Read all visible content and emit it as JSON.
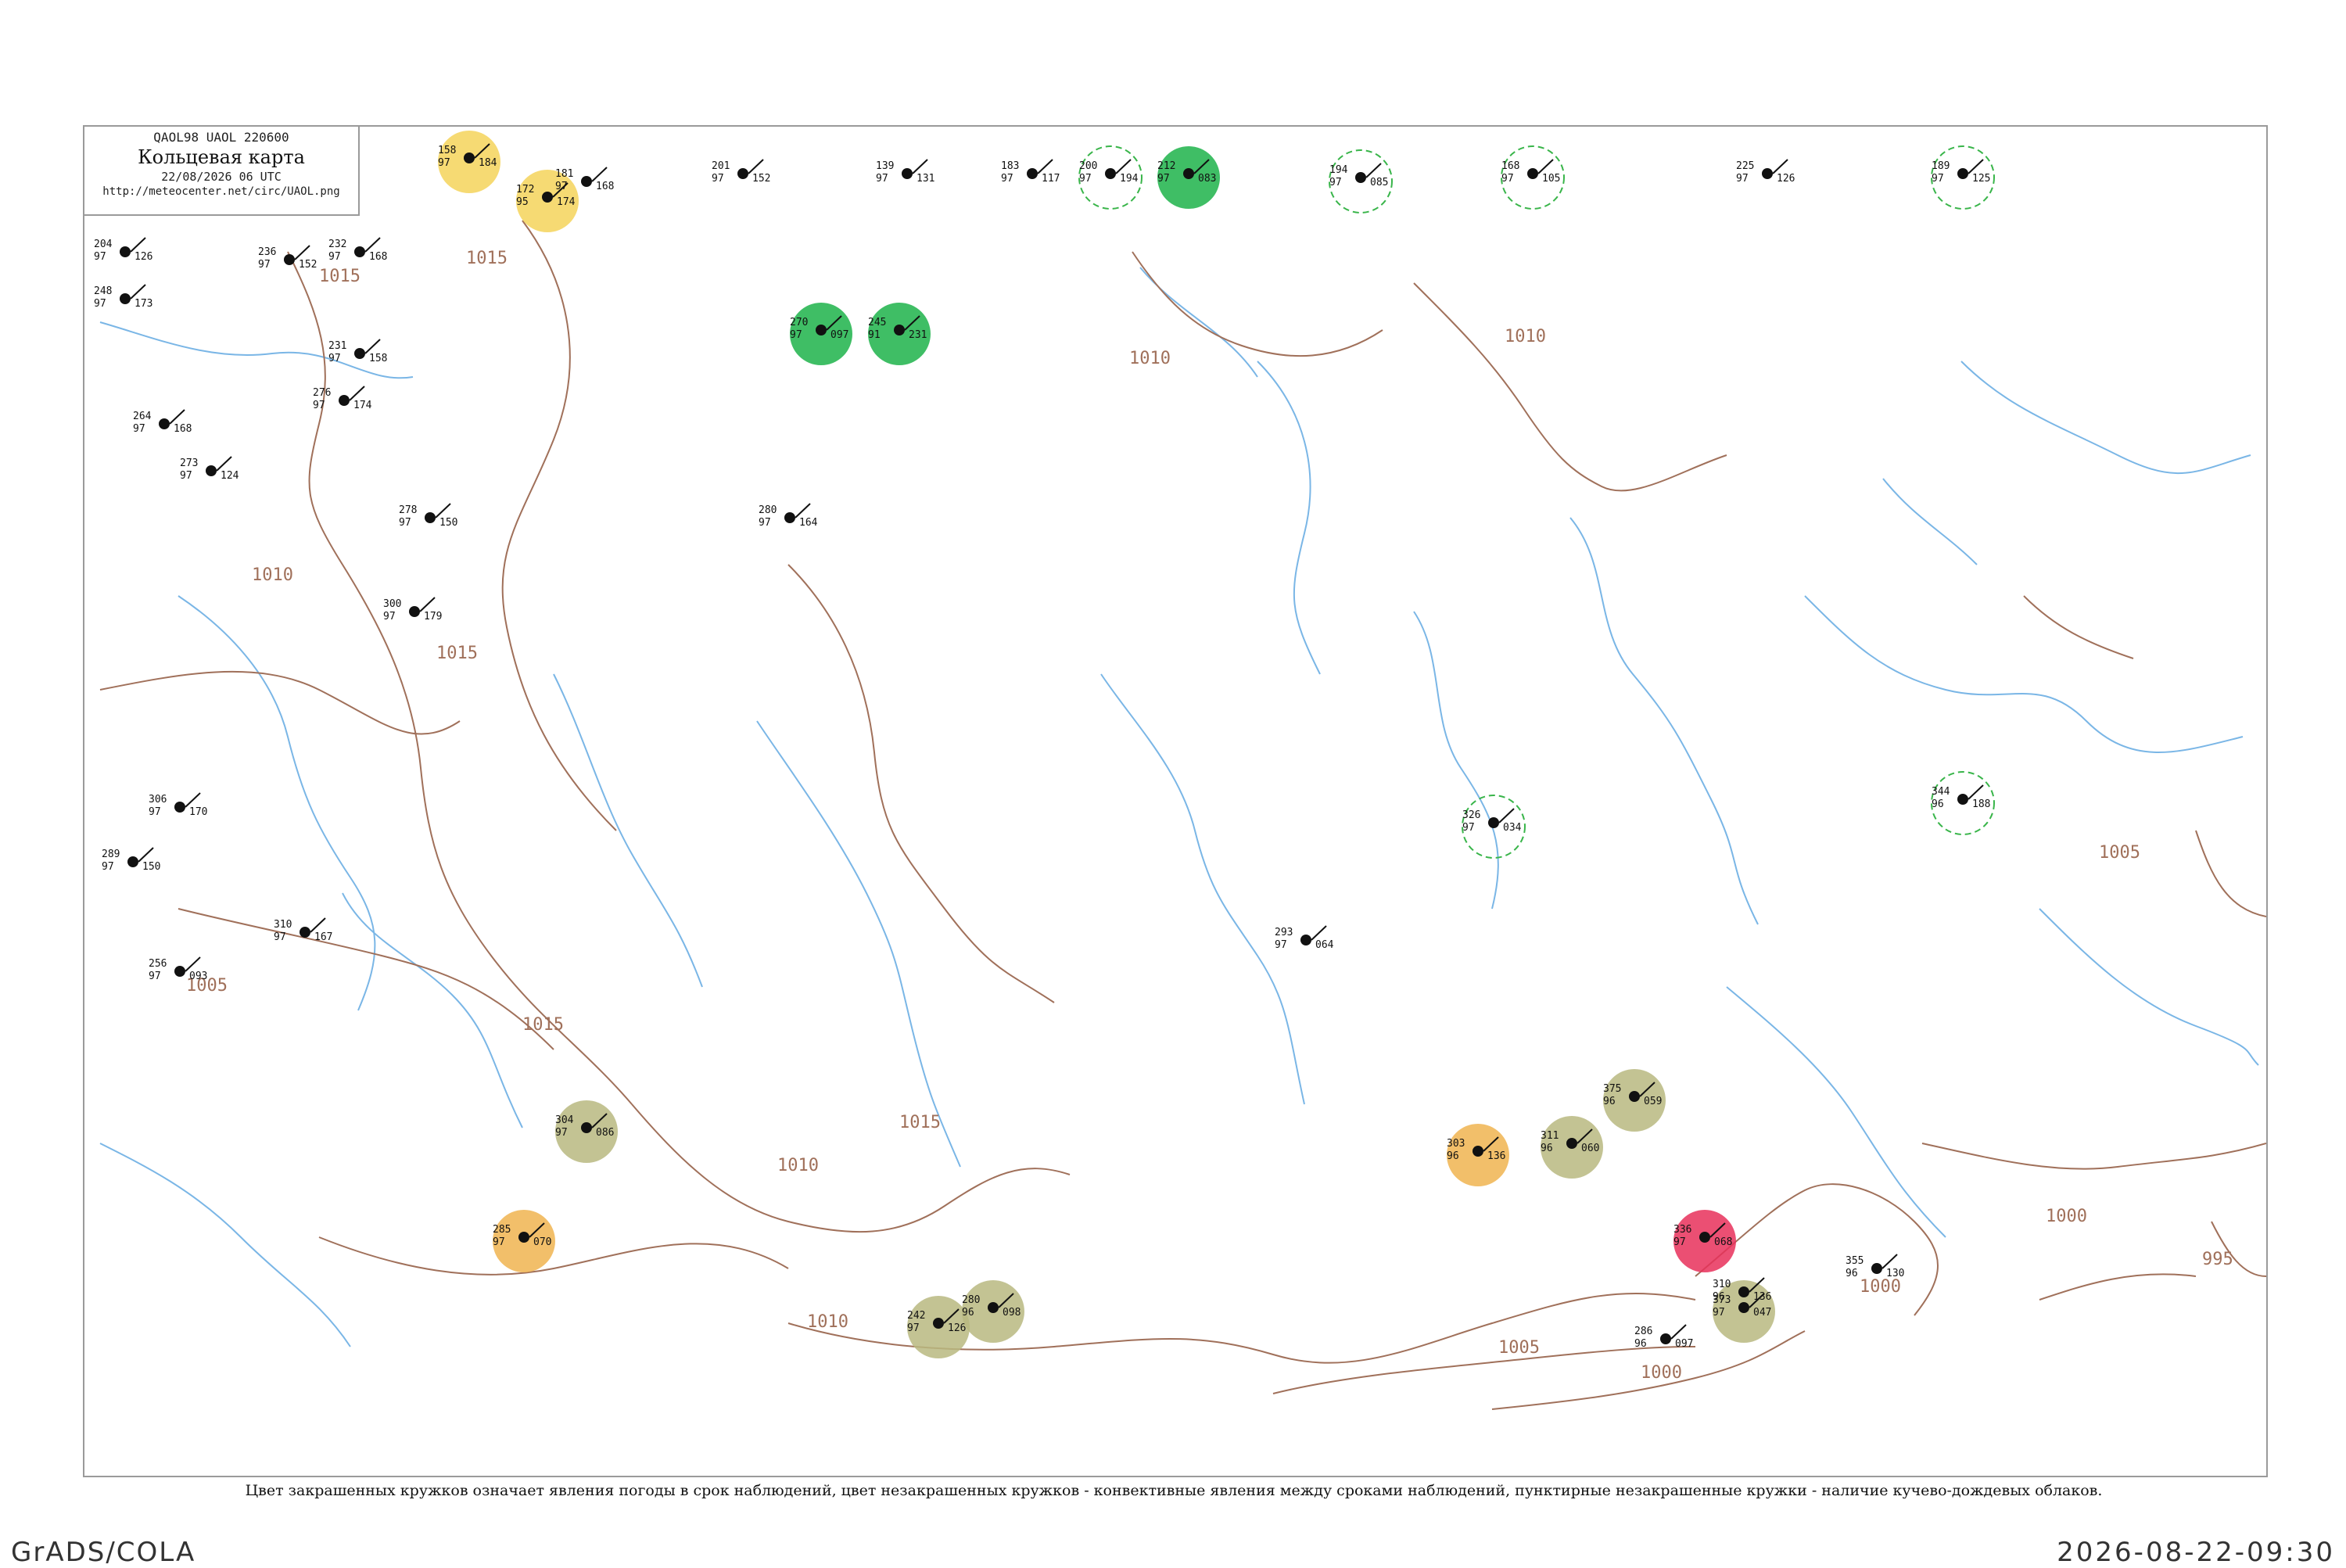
{
  "header": {
    "code": "QAOL98  UAOL  220600",
    "title": "Кольцевая карта",
    "datetime": "22/08/2026 06 UTC",
    "url": "http://meteocenter.net/circ/UAOL.png"
  },
  "caption": "Цвет закрашенных кружков означает явления погоды в срок наблюдений, цвет незакрашенных кружков - конвективные явления между сроками наблюдений, пунктирные незакрашенные кружки - наличие кучево-дождевых облаков.",
  "footer": {
    "left": "GrADS/COLA",
    "right": "2026-08-22-09:30"
  },
  "isobar_labels": [
    "1015",
    "1010",
    "1015",
    "1010",
    "1015",
    "1005",
    "1015",
    "1015",
    "1010",
    "1010",
    "1005",
    "1000",
    "1000",
    "1000",
    "995",
    "1005",
    "1010"
  ],
  "colors": {
    "isobar": "#a0705a",
    "water": "#7ab6e6",
    "rain": "#1db34a",
    "fog": "#f4d45a",
    "haze": "#f0b450",
    "dust": "#b8b880",
    "storm": "#e8305a",
    "cb_ring": "#39b54a"
  },
  "stations": [
    {
      "t": "158",
      "p": "184",
      "v": "97"
    },
    {
      "t": "172",
      "p": "174",
      "v": "95"
    },
    {
      "t": "181",
      "p": "168",
      "v": "97"
    },
    {
      "t": "201",
      "p": "152",
      "v": "97"
    },
    {
      "t": "139",
      "p": "131",
      "v": "97"
    },
    {
      "t": "183",
      "p": "117",
      "v": "97"
    },
    {
      "t": "200",
      "p": "194",
      "v": "97"
    },
    {
      "t": "212",
      "p": "083",
      "v": "97"
    },
    {
      "t": "194",
      "p": "085",
      "v": "97"
    },
    {
      "t": "168",
      "p": "105",
      "v": "97"
    },
    {
      "t": "225",
      "p": "126",
      "v": "97"
    },
    {
      "t": "189",
      "p": "125",
      "v": "97"
    },
    {
      "t": "204",
      "p": "126",
      "v": "97"
    },
    {
      "t": "236",
      "p": "152",
      "v": "97"
    },
    {
      "t": "232",
      "p": "168",
      "v": "97"
    },
    {
      "t": "248",
      "p": "173",
      "v": "97"
    },
    {
      "t": "231",
      "p": "158",
      "v": "97"
    },
    {
      "t": "276",
      "p": "174",
      "v": "97"
    },
    {
      "t": "264",
      "p": "168",
      "v": "97"
    },
    {
      "t": "273",
      "p": "124",
      "v": "97"
    },
    {
      "t": "278",
      "p": "150",
      "v": "97"
    },
    {
      "t": "280",
      "p": "164",
      "v": "97"
    },
    {
      "t": "300",
      "p": "179",
      "v": "97"
    },
    {
      "t": "306",
      "p": "170",
      "v": "97"
    },
    {
      "t": "289",
      "p": "150",
      "v": "97"
    },
    {
      "t": "310",
      "p": "167",
      "v": "97"
    },
    {
      "t": "256",
      "p": "093",
      "v": "97"
    },
    {
      "t": "293",
      "p": "064",
      "v": "97"
    },
    {
      "t": "326",
      "p": "034",
      "v": "97"
    },
    {
      "t": "344",
      "p": "188",
      "v": "96"
    },
    {
      "t": "304",
      "p": "086",
      "v": "97"
    },
    {
      "t": "285",
      "p": "070",
      "v": "97"
    },
    {
      "t": "242",
      "p": "126",
      "v": "97"
    },
    {
      "t": "280",
      "p": "098",
      "v": "96"
    },
    {
      "t": "375",
      "p": "059",
      "v": "96"
    },
    {
      "t": "311",
      "p": "060",
      "v": "96"
    },
    {
      "t": "303",
      "p": "136",
      "v": "96"
    },
    {
      "t": "336",
      "p": "068",
      "v": "97"
    },
    {
      "t": "373",
      "p": "047",
      "v": "97"
    },
    {
      "t": "355",
      "p": "130",
      "v": "96"
    },
    {
      "t": "310",
      "p": "136",
      "v": "96"
    },
    {
      "t": "286",
      "p": "097",
      "v": "96"
    },
    {
      "t": "270",
      "p": "097",
      "v": "97"
    },
    {
      "t": "245",
      "p": "231",
      "v": "91"
    }
  ]
}
